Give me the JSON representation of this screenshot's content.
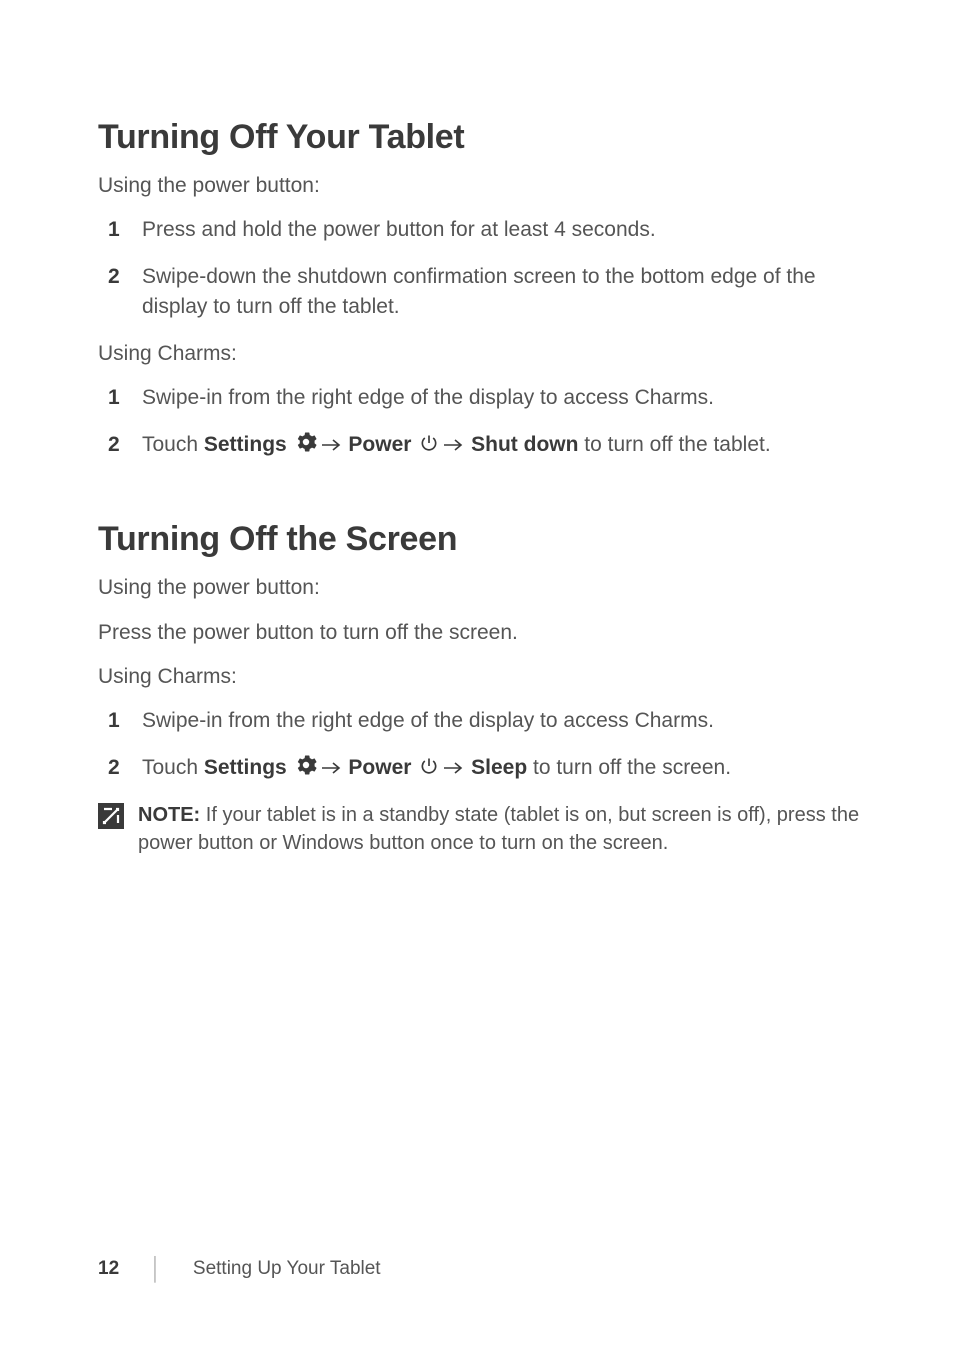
{
  "section1": {
    "heading": "Turning Off Your Tablet",
    "intro1": "Using the power button:",
    "list1": {
      "i1": {
        "n": "1",
        "t": "Press and hold the power button for at least 4 seconds."
      },
      "i2": {
        "n": "2",
        "t": "Swipe-down the shutdown confirmation screen to the bottom edge of the display to turn off the tablet."
      }
    },
    "intro2": "Using Charms:",
    "list2": {
      "i1": {
        "n": "1",
        "t": "Swipe-in from the right edge of the display to access Charms."
      },
      "i2": {
        "n": "2",
        "pre": "Touch ",
        "b1": "Settings",
        "b2": "Power",
        "b3": "Shut down",
        "post": " to turn off the tablet."
      }
    }
  },
  "section2": {
    "heading": "Turning Off the Screen",
    "intro1": "Using the power button:",
    "para1": "Press the power button to turn off the screen.",
    "intro2": "Using Charms:",
    "list1": {
      "i1": {
        "n": "1",
        "t": "Swipe-in from the right edge of the display to access Charms."
      },
      "i2": {
        "n": "2",
        "pre": "Touch ",
        "b1": "Settings",
        "b2": "Power",
        "b3": "Sleep",
        "post": " to turn off the screen."
      }
    },
    "note": {
      "label": "NOTE:",
      "text": " If your tablet is in a standby state (tablet is on, but screen is off), press the power button or Windows button once to turn on the screen."
    }
  },
  "footer": {
    "page": "12",
    "chapter": "Setting Up Your Tablet"
  }
}
